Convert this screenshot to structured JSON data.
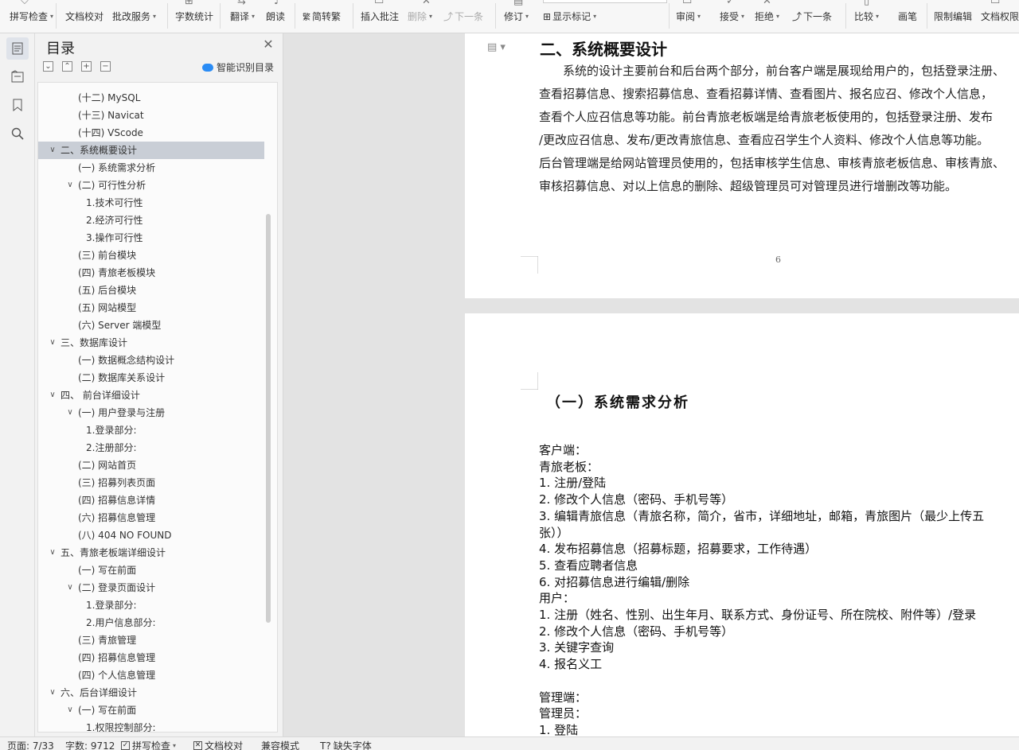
{
  "ribbon": {
    "items": [
      {
        "label": "拼写检查",
        "caret": true
      },
      {
        "label": "文档校对",
        "caret": false
      },
      {
        "label": "批改服务",
        "caret": true
      },
      {
        "label": "字数统计",
        "caret": false
      },
      {
        "label": "翻译",
        "caret": true
      },
      {
        "label": "朗读",
        "caret": false
      },
      {
        "label": "简转繁",
        "caret": false
      },
      {
        "label": "插入批注",
        "caret": false
      },
      {
        "label": "删除",
        "caret": true
      },
      {
        "label": "下一条",
        "caret": false
      },
      {
        "label": "修订",
        "caret": true
      },
      {
        "label": "显示标记",
        "caret": true
      },
      {
        "label": "审阅",
        "caret": true
      },
      {
        "label": "接受",
        "caret": true
      },
      {
        "label": "拒绝",
        "caret": true
      },
      {
        "label": "下一条",
        "caret": false
      },
      {
        "label": "比较",
        "caret": true
      },
      {
        "label": "画笔",
        "caret": false
      },
      {
        "label": "限制编辑",
        "caret": false
      },
      {
        "label": "文档权限",
        "caret": false
      }
    ]
  },
  "toc": {
    "title": "目录",
    "smart_label": "智能识别目录",
    "items": [
      {
        "label": "(十二) MySQL",
        "level": 2,
        "arrow": ""
      },
      {
        "label": "(十三) Navicat",
        "level": 2,
        "arrow": ""
      },
      {
        "label": "(十四) VScode",
        "level": 2,
        "arrow": ""
      },
      {
        "label": "二、系统概要设计",
        "level": 1,
        "arrow": "open",
        "selected": true
      },
      {
        "label": "(一) 系统需求分析",
        "level": 2,
        "arrow": ""
      },
      {
        "label": "(二) 可行性分析",
        "level": 2,
        "arrow": "open"
      },
      {
        "label": "1.技术可行性",
        "level": 3,
        "arrow": ""
      },
      {
        "label": "2.经济可行性",
        "level": 3,
        "arrow": ""
      },
      {
        "label": "3.操作可行性",
        "level": 3,
        "arrow": ""
      },
      {
        "label": "(三) 前台模块",
        "level": 2,
        "arrow": ""
      },
      {
        "label": "(四) 青旅老板模块",
        "level": 2,
        "arrow": ""
      },
      {
        "label": "(五) 后台模块",
        "level": 2,
        "arrow": ""
      },
      {
        "label": "(五)   网站模型",
        "level": 2,
        "arrow": ""
      },
      {
        "label": "(六) Server 端模型",
        "level": 2,
        "arrow": ""
      },
      {
        "label": "三、数据库设计",
        "level": 1,
        "arrow": "open"
      },
      {
        "label": "(一) 数据概念结构设计",
        "level": 2,
        "arrow": ""
      },
      {
        "label": "(二) 数据库关系设计",
        "level": 2,
        "arrow": ""
      },
      {
        "label": "四、  前台详细设计",
        "level": 1,
        "arrow": "open"
      },
      {
        "label": "(一) 用户登录与注册",
        "level": 2,
        "arrow": "open"
      },
      {
        "label": "1.登录部分:",
        "level": 3,
        "arrow": ""
      },
      {
        "label": "2.注册部分:",
        "level": 3,
        "arrow": ""
      },
      {
        "label": "(二) 网站首页",
        "level": 2,
        "arrow": ""
      },
      {
        "label": "(三) 招募列表页面",
        "level": 2,
        "arrow": ""
      },
      {
        "label": "(四) 招募信息详情",
        "level": 2,
        "arrow": ""
      },
      {
        "label": "(六) 招募信息管理",
        "level": 2,
        "arrow": ""
      },
      {
        "label": "(八) 404 NO FOUND",
        "level": 2,
        "arrow": ""
      },
      {
        "label": "五、青旅老板端详细设计",
        "level": 1,
        "arrow": "open"
      },
      {
        "label": "(一) 写在前面",
        "level": 2,
        "arrow": ""
      },
      {
        "label": "(二)   登录页面设计",
        "level": 2,
        "arrow": "open"
      },
      {
        "label": "1.登录部分:",
        "level": 3,
        "arrow": ""
      },
      {
        "label": "2.用户信息部分:",
        "level": 3,
        "arrow": ""
      },
      {
        "label": "(三)   青旅管理",
        "level": 2,
        "arrow": ""
      },
      {
        "label": "(四)   招募信息管理",
        "level": 2,
        "arrow": ""
      },
      {
        "label": "(四)   个人信息管理",
        "level": 2,
        "arrow": ""
      },
      {
        "label": "六、后台详细设计",
        "level": 1,
        "arrow": "open"
      },
      {
        "label": "(一) 写在前面",
        "level": 2,
        "arrow": "open"
      },
      {
        "label": "1.权限控制部分:",
        "level": 3,
        "arrow": ""
      }
    ]
  },
  "document": {
    "page1": {
      "heading": "二、系统概要设计",
      "paragraph_lines": [
        "　　系统的设计主要前台和后台两个部分，前台客户端是展现给用户的，包括登录注册、",
        "查看招募信息、搜索招募信息、查看招募详情、查看图片、报名应召、修改个人信息，",
        "查看个人应召信息等功能。前台青旅老板端是给青旅老板使用的，包括登录注册、发布",
        "/更改应召信息、发布/更改青旅信息、查看应召学生个人资料、修改个人信息等功能。",
        "后台管理端是给网站管理员使用的，包括审核学生信息、审核青旅老板信息、审核青旅、",
        "审核招募信息、对以上信息的删除、超级管理员可对管理员进行增删改等功能。"
      ],
      "page_number": "6"
    },
    "page2": {
      "heading": "（一）系统需求分析",
      "lines": [
        "客户端：",
        "青旅老板：",
        "1.   注册/登陆",
        "2.   修改个人信息（密码、手机号等）",
        "3.   编辑青旅信息（青旅名称，简介，省市，详细地址，邮箱，青旅图片（最少上传五",
        "张））",
        "4.   发布招募信息（招募标题，招募要求，工作待遇）",
        "5.   查看应聘者信息",
        "6.   对招募信息进行编辑/删除",
        "用户：",
        "1.   注册（姓名、性别、出生年月、联系方式、身份证号、所在院校、附件等）/登录",
        "2.   修改个人信息（密码、手机号等）",
        "3.   关键字查询",
        "4.   报名义工",
        "",
        "管理端：",
        "管理员：",
        "1.   登陆"
      ]
    }
  },
  "status": {
    "page": "页面: 7/33",
    "words": "字数: 9712",
    "spell": "拼写检查",
    "proof": "文档校对",
    "compat": "兼容模式",
    "missing_font": "缺失字体"
  }
}
